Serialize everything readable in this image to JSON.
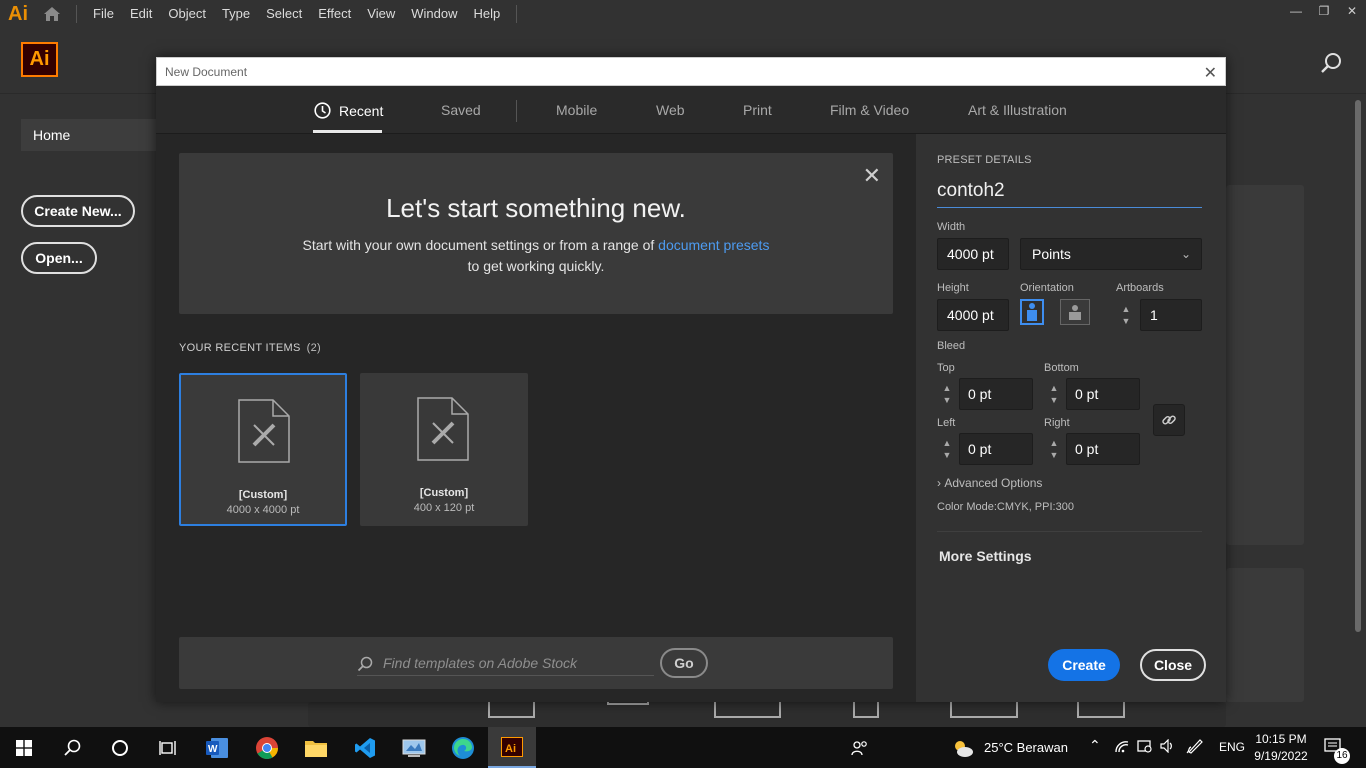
{
  "menubar": {
    "app_mini": "Ai",
    "items": [
      "File",
      "Edit",
      "Object",
      "Type",
      "Select",
      "Effect",
      "View",
      "Window",
      "Help"
    ]
  },
  "home": {
    "logo": "Ai",
    "nav_home": "Home",
    "create_new": "Create New...",
    "open": "Open..."
  },
  "dialog": {
    "title": "New Document",
    "tabs": [
      "Recent",
      "Saved",
      "Mobile",
      "Web",
      "Print",
      "Film & Video",
      "Art & Illustration"
    ],
    "active_tab": "Recent",
    "hero": {
      "title": "Let's start something new.",
      "line1_pre": "Start with your own document settings or from a range of ",
      "line1_link": "document presets",
      "line2": "to get working quickly."
    },
    "recent": {
      "header": "YOUR RECENT ITEMS",
      "count": "(2)",
      "items": [
        {
          "name": "[Custom]",
          "dims": "4000 x 4000 pt"
        },
        {
          "name": "[Custom]",
          "dims": "400 x 120 pt"
        }
      ]
    },
    "stock": {
      "placeholder": "Find templates on Adobe Stock",
      "go": "Go"
    },
    "preset": {
      "header": "PRESET DETAILS",
      "name": "contoh2",
      "width_label": "Width",
      "width": "4000 pt",
      "units": "Points",
      "height_label": "Height",
      "height": "4000 pt",
      "orientation_label": "Orientation",
      "artboards_label": "Artboards",
      "artboards": "1",
      "bleed_label": "Bleed",
      "top_label": "Top",
      "top": "0 pt",
      "bottom_label": "Bottom",
      "bottom": "0 pt",
      "left_label": "Left",
      "left": "0 pt",
      "right_label": "Right",
      "right": "0 pt",
      "advanced": "Advanced Options",
      "color_mode": "Color Mode:CMYK, PPI:300",
      "more_settings": "More Settings",
      "create": "Create",
      "close": "Close"
    }
  },
  "taskbar": {
    "weather": "25°C  Berawan",
    "lang": "ENG",
    "time": "10:15 PM",
    "date": "9/19/2022",
    "notif_count": "16"
  },
  "colors": {
    "accent": "#1473e6",
    "link": "#4d9bf0",
    "ai_orange": "#ff9a00"
  }
}
